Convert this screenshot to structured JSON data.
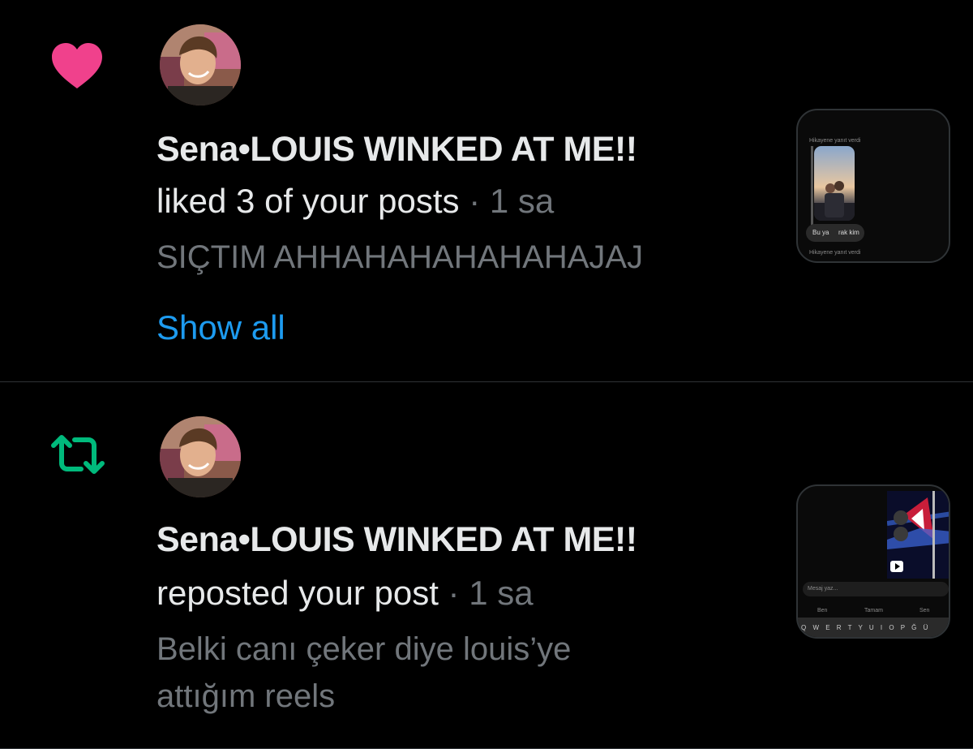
{
  "colors": {
    "background": "#000000",
    "like": "#f91880",
    "repost": "#00ba7c",
    "link": "#1d9bf0",
    "secondary_text": "#71767b",
    "divider": "#2f3336"
  },
  "notifications": [
    {
      "type_icon": "heart-icon",
      "name": "Sena•LOUIS WINKED AT ME!!",
      "action": "liked 3 of your posts",
      "separator": "·",
      "time": "1 sa",
      "post_text": "SIÇTIM AHHAHAHAHAHAHAJAJ",
      "show_all": "Show all",
      "thumbnail": {
        "header": "Hikayene yanıt verdi",
        "bubble": "Bu ya",
        "bubble_end": "rak kim",
        "footer": "Hikayene yanıt verdi"
      }
    },
    {
      "type_icon": "repost-icon",
      "name": "Sena•LOUIS WINKED AT ME!!",
      "action": "reposted your post",
      "separator": "·",
      "time": "1 sa",
      "post_text_lines": [
        "Belki canı çeker diye louis’ye",
        "attığım reels"
      ],
      "thumbnail": {
        "input_placeholder": "Mesaj yaz...",
        "suggestions": [
          "Ben",
          "Tamam",
          "Sen"
        ],
        "keys": "Q W E R T Y U I O P Ğ Ü"
      }
    }
  ]
}
